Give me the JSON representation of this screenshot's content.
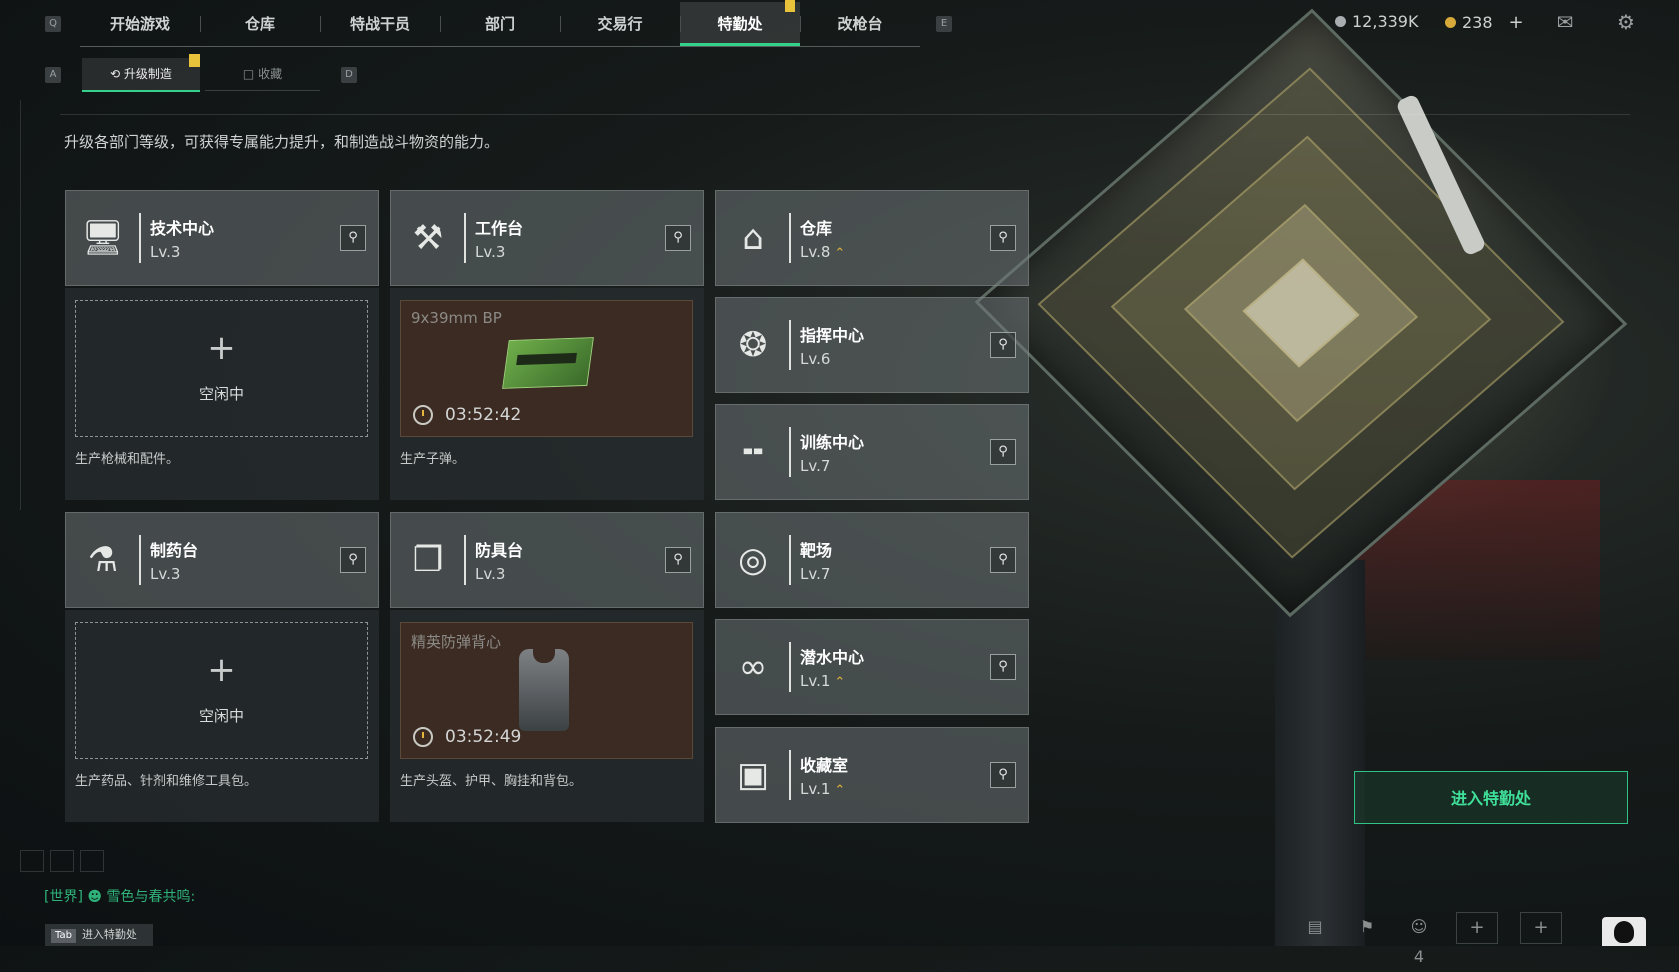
{
  "nav": {
    "left_key": "Q",
    "right_key": "E",
    "tabs": [
      {
        "label": "开始游戏",
        "active": false
      },
      {
        "label": "仓库",
        "active": false
      },
      {
        "label": "特战干员",
        "active": false
      },
      {
        "label": "部门",
        "active": false
      },
      {
        "label": "交易行",
        "active": false
      },
      {
        "label": "特勤处",
        "active": true
      },
      {
        "label": "改枪台",
        "active": false
      }
    ]
  },
  "currency": {
    "silver": "12,339K",
    "gold": "238",
    "add": "+"
  },
  "subnav": {
    "left_key": "A",
    "right_key": "D",
    "tabs": [
      {
        "label": "升级制造",
        "active": true
      },
      {
        "label": "收藏",
        "active": false
      }
    ]
  },
  "description": "升级各部门等级，可获得专属能力提升，和制造战斗物资的能力。",
  "departments": {
    "tech": {
      "name": "技术中心",
      "level": "Lv.3",
      "icon": "monitor-icon",
      "panel_text": "生产枪械和配件。",
      "slot": {
        "state": "idle",
        "plus": "+",
        "label": "空闲中"
      }
    },
    "workbench": {
      "name": "工作台",
      "level": "Lv.3",
      "icon": "hammer-wrench-icon",
      "panel_text": "生产子弹。",
      "slot": {
        "state": "busy",
        "item": "9x39mm BP",
        "timer": "03:52:42"
      }
    },
    "pharmacy": {
      "name": "制药台",
      "level": "Lv.3",
      "icon": "microscope-icon",
      "panel_text": "生产药品、针剂和维修工具包。",
      "slot": {
        "state": "idle",
        "plus": "+",
        "label": "空闲中"
      }
    },
    "armor": {
      "name": "防具台",
      "level": "Lv.3",
      "icon": "cubes-icon",
      "panel_text": "生产头盔、护甲、胸挂和背包。",
      "slot": {
        "state": "busy",
        "item": "精英防弹背心",
        "timer": "03:52:49"
      }
    },
    "warehouse": {
      "name": "仓库",
      "level": "Lv.8",
      "icon": "warehouse-icon",
      "upgradable": true
    },
    "command": {
      "name": "指挥中心",
      "level": "Lv.6",
      "icon": "command-icon",
      "upgradable": false
    },
    "training": {
      "name": "训练中心",
      "level": "Lv.7",
      "icon": "dumbbell-icon",
      "upgradable": false
    },
    "range": {
      "name": "靶场",
      "level": "Lv.7",
      "icon": "target-icon",
      "upgradable": false
    },
    "diving": {
      "name": "潜水中心",
      "level": "Lv.1",
      "icon": "diving-mask-icon",
      "upgradable": true
    },
    "collection": {
      "name": "收藏室",
      "level": "Lv.1",
      "icon": "display-case-icon",
      "upgradable": true
    }
  },
  "enter_button": "进入特勤处",
  "chat": {
    "channel": "[世界]",
    "user": "雪色与春共鸣",
    "suffix": ":"
  },
  "hint": {
    "key": "Tab",
    "label": "进入特勤处"
  },
  "bottom": {
    "friends_count": "4"
  },
  "colors": {
    "accent": "#33d18a",
    "alert": "#e8c23a",
    "busy_slot": "#3b2b22"
  }
}
